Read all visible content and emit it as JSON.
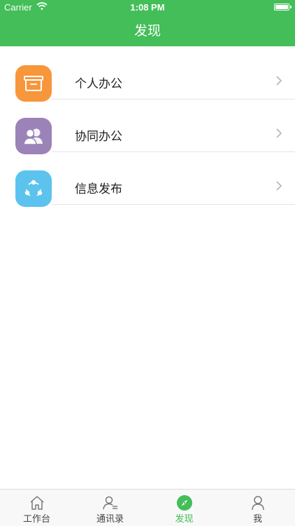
{
  "status_bar": {
    "carrier": "Carrier",
    "time": "1:08 PM"
  },
  "nav": {
    "title": "发现"
  },
  "items": [
    {
      "label": "个人办公",
      "icon_color": "#f7963b",
      "icon": "box-icon"
    },
    {
      "label": "协同办公",
      "icon_color": "#9b83b8",
      "icon": "people-icon"
    },
    {
      "label": "信息发布",
      "icon_color": "#5cc3ee",
      "icon": "share-icon"
    }
  ],
  "tabs": [
    {
      "label": "工作台",
      "icon": "home-icon",
      "active": false
    },
    {
      "label": "通讯录",
      "icon": "contacts-icon",
      "active": false
    },
    {
      "label": "发现",
      "icon": "compass-icon",
      "active": true
    },
    {
      "label": "我",
      "icon": "person-icon",
      "active": false
    }
  ],
  "colors": {
    "brand": "#43be58",
    "active_tab": "#43be58"
  }
}
